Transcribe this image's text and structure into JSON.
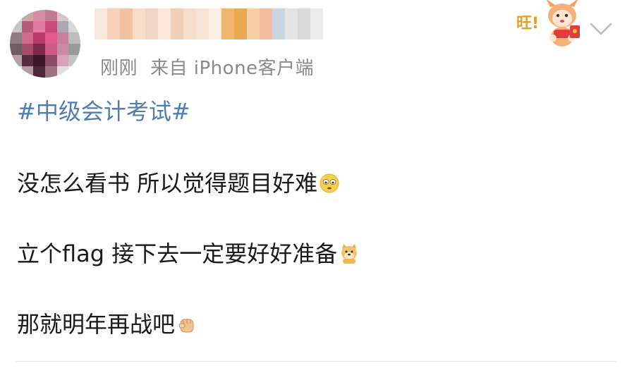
{
  "post": {
    "time": "刚刚",
    "source": "来自 iPhone客户端",
    "topic": "#中级会计考试#",
    "lines": [
      "没怎么看书 所以觉得题目好难",
      "立个flag 接下去一定要好好准备",
      "那就明年再战吧"
    ],
    "sticker_text": "旺!"
  },
  "colors": {
    "topic": "#507daf",
    "meta": "#8a8a8a",
    "text": "#1a1a1a"
  },
  "icons": {
    "avatar": "user-avatar-mosaic",
    "sticker": "dog-sticker-icon",
    "chevron": "chevron-down-icon",
    "line1_emoji": "dizzy-face-emoji-icon",
    "line2_emoji": "doge-emoji-icon",
    "line3_emoji": "fist-emoji-icon"
  }
}
